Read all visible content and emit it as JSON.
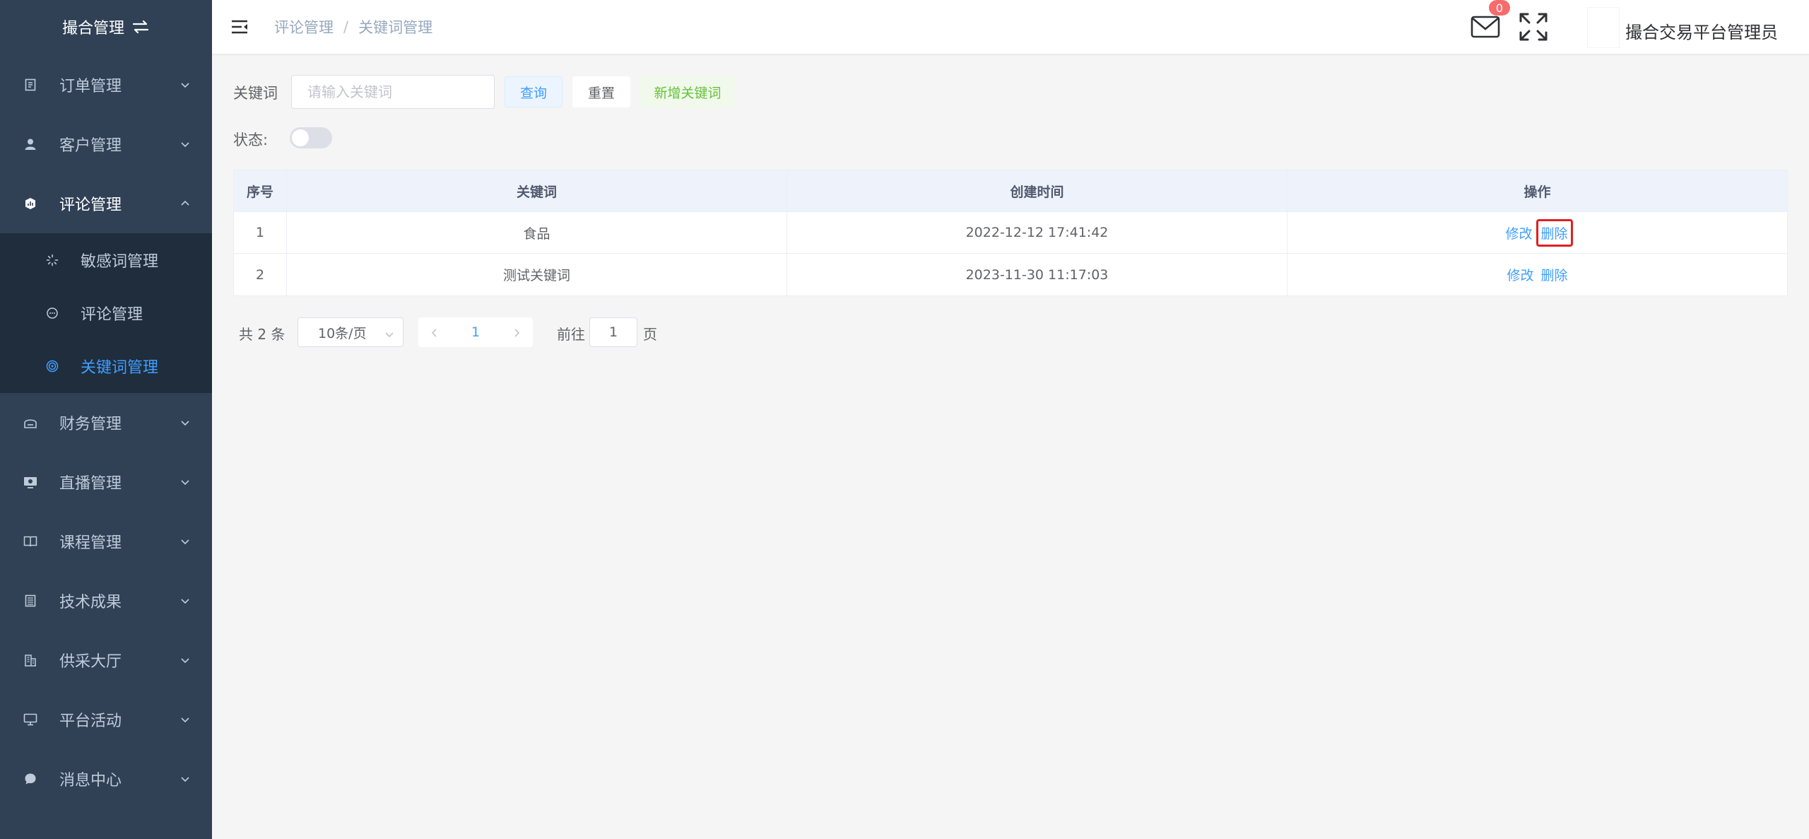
{
  "app": {
    "title": "撮合管理"
  },
  "sidebar": {
    "items": [
      {
        "label": "订单管理",
        "icon": "document-icon"
      },
      {
        "label": "客户管理",
        "icon": "user-icon"
      },
      {
        "label": "评论管理",
        "icon": "chart-shield-icon",
        "expanded": true
      },
      {
        "label": "财务管理",
        "icon": "finance-icon"
      },
      {
        "label": "直播管理",
        "icon": "live-icon"
      },
      {
        "label": "课程管理",
        "icon": "book-icon"
      },
      {
        "label": "技术成果",
        "icon": "list-icon"
      },
      {
        "label": "供采大厅",
        "icon": "building-icon"
      },
      {
        "label": "平台活动",
        "icon": "monitor-icon"
      },
      {
        "label": "消息中心",
        "icon": "message-icon"
      }
    ],
    "submenu": [
      {
        "label": "敏感词管理",
        "icon": "loading-icon"
      },
      {
        "label": "评论管理",
        "icon": "chat-dot-icon"
      },
      {
        "label": "关键词管理",
        "icon": "target-icon",
        "active": true
      }
    ]
  },
  "header": {
    "breadcrumb": [
      "评论管理",
      "关键词管理"
    ],
    "breadcrumb_sep": "/",
    "mail_count": "0",
    "user_name": "撮合交易平台管理员"
  },
  "filter": {
    "keyword_label": "关键词",
    "keyword_placeholder": "请输入关键词",
    "query_label": "查询",
    "reset_label": "重置",
    "add_label": "新增关键词",
    "status_label": "状态:",
    "status_on": false
  },
  "table": {
    "columns": [
      "序号",
      "关键词",
      "创建时间",
      "操作"
    ],
    "rows": [
      {
        "index": "1",
        "keyword": "食品",
        "created": "2022-12-12 17:41:42",
        "edit": "修改",
        "delete": "删除"
      },
      {
        "index": "2",
        "keyword": "测试关键词",
        "created": "2023-11-30 11:17:03",
        "edit": "修改",
        "delete": "删除"
      }
    ]
  },
  "pagination": {
    "total": "共 2 条",
    "page_size": "10条/页",
    "current_page": "1",
    "goto_label": "前往",
    "goto_value": "1",
    "page_label": "页"
  },
  "colors": {
    "sidebar_bg": "#304156",
    "submenu_bg": "#1f2d3d",
    "accent": "#409eff",
    "success": "#67c23a",
    "danger": "#f56c6c",
    "highlight_box": "#e02020"
  }
}
